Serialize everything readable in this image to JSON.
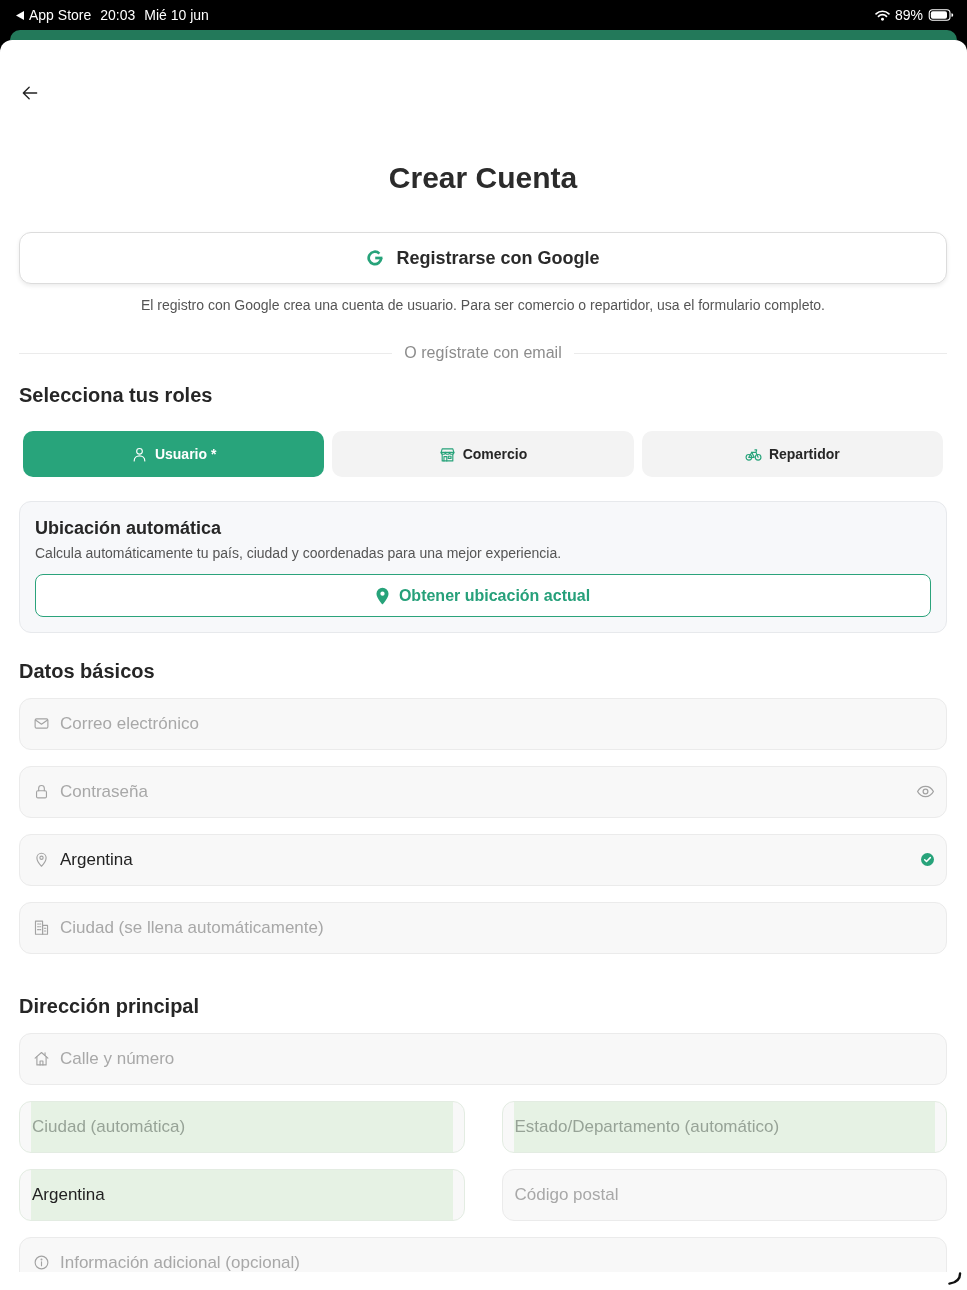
{
  "status_bar": {
    "back_app": "App Store",
    "time": "20:03",
    "date": "Mié 10 jun",
    "battery": "89%"
  },
  "header": {
    "title": "Crear Cuenta"
  },
  "google_signup": {
    "label": "Registrarse con Google",
    "note": "El registro con Google crea una cuenta de usuario. Para ser comercio o repartidor, usa el formulario completo."
  },
  "divider": {
    "label": "O regístrate con email"
  },
  "roles": {
    "title": "Selecciona tus roles",
    "items": [
      {
        "kind": "user",
        "label": "Usuario *",
        "selected": true
      },
      {
        "kind": "store",
        "label": "Comercio",
        "selected": false
      },
      {
        "kind": "bike",
        "label": "Repartidor",
        "selected": false
      }
    ]
  },
  "location": {
    "title": "Ubicación automática",
    "description": "Calcula automáticamente tu país, ciudad y coordenadas para una mejor experiencia.",
    "button": "Obtener ubicación actual"
  },
  "basic_data": {
    "title": "Datos básicos",
    "fields": [
      {
        "kind": "email",
        "placeholder": "Correo electrónico",
        "verified": false
      },
      {
        "kind": "password",
        "placeholder": "Contraseña",
        "verified": false
      },
      {
        "kind": "country",
        "value": "Argentina",
        "verified": true
      },
      {
        "kind": "city",
        "placeholder": "Ciudad (se llena automáticamente)",
        "verified": false
      }
    ]
  },
  "address": {
    "title": "Dirección principal",
    "fields": [
      {
        "kind": "street",
        "placeholder": "Calle y número",
        "autofilled": false
      },
      {
        "kind": "plain",
        "placeholder": "Ciudad (automática)",
        "autofilled": true
      },
      {
        "kind": "plain",
        "placeholder": "Estado/Departamento (automático)",
        "autofilled": true
      },
      {
        "kind": "plain",
        "value": "Argentina",
        "autofilled": true
      },
      {
        "kind": "plain",
        "placeholder": "Código postal",
        "autofilled": false
      },
      {
        "kind": "info",
        "placeholder": "Información adicional (opcional)",
        "autofilled": false
      }
    ]
  }
}
